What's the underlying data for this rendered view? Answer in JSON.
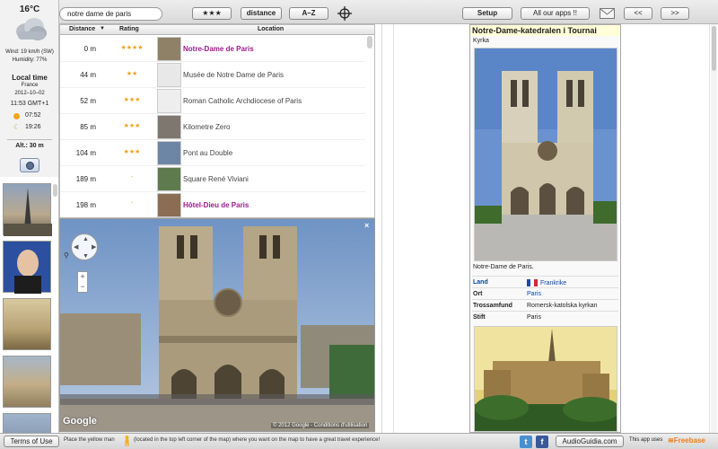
{
  "toolbar": {
    "search_value": "notre dame de paris",
    "stars_label": "★★★",
    "distance_label": "distance",
    "az_label": "A–Z",
    "setup_label": "Setup",
    "apps_label": "All our apps !!",
    "prev_label": "<<",
    "next_label": ">>"
  },
  "weather": {
    "temperature": "16°C",
    "wind": "Wind: 19 km/h (SW)",
    "humidity": "Humidity: 77%",
    "local_time_label": "Local time",
    "country": "France",
    "date": "2012–10–02",
    "time": "11:53 GMT+1",
    "sunrise": "07:52",
    "sunset": "19:26",
    "altitude": "Alt.: 30 m"
  },
  "table": {
    "headers": {
      "distance": "Distance",
      "rating": "Rating",
      "location": "Location"
    },
    "rows": [
      {
        "distance": "0 m",
        "rating": "★★★★",
        "name": "Notre-Dame de Paris",
        "highlight": true
      },
      {
        "distance": "44 m",
        "rating": "★★",
        "name": "Musée de Notre Dame de Paris",
        "highlight": false
      },
      {
        "distance": "52 m",
        "rating": "★★★",
        "name": "Roman Catholic Archdiocese of Paris",
        "highlight": false
      },
      {
        "distance": "85 m",
        "rating": "★★★",
        "name": "Kilometre Zero",
        "highlight": false
      },
      {
        "distance": "104 m",
        "rating": "★★★",
        "name": "Pont au Double",
        "highlight": false
      },
      {
        "distance": "189 m",
        "rating": "-",
        "name": "Square René Viviani",
        "highlight": false
      },
      {
        "distance": "198 m",
        "rating": "-",
        "name": "Hôtel-Dieu de Paris",
        "highlight": true
      }
    ]
  },
  "map": {
    "logo": "Google",
    "copyright": "© 2012 Google - Conditions d'utilisation",
    "close": "×",
    "zoom_in": "+",
    "zoom_out": "−"
  },
  "wiki": {
    "title": "Notre-Dame-katedralen i Tournai",
    "subtitle": "Kyrka",
    "caption": "Notre-Dame de Paris.",
    "rows": [
      {
        "key": "Land",
        "value": "Frankrike",
        "key_link": true,
        "value_link": true,
        "flag": true
      },
      {
        "key": "Ort",
        "value": "Paris",
        "key_link": false,
        "value_link": true,
        "flag": false
      },
      {
        "key": "Trossamfund",
        "value": "Romersk-katolska kyrkan",
        "key_link": false,
        "value_link": false,
        "flag": false
      },
      {
        "key": "Stift",
        "value": "Paris",
        "key_link": false,
        "value_link": false,
        "flag": false
      }
    ]
  },
  "bottom": {
    "terms_label": "Terms of Use",
    "hint_a": "Place the yellow man",
    "hint_b": "(located in the top left corner of the map) where you want on the map to have a great travel experience!",
    "audio_label": "AudioGuidia.com",
    "app_uses": "This app uses",
    "freebase": "Freebase"
  },
  "colors": {
    "highlight": "#9b1b8c",
    "star": "#f0a21c",
    "link": "#0645ad",
    "wiki_title_bg": "#ffffd7"
  }
}
